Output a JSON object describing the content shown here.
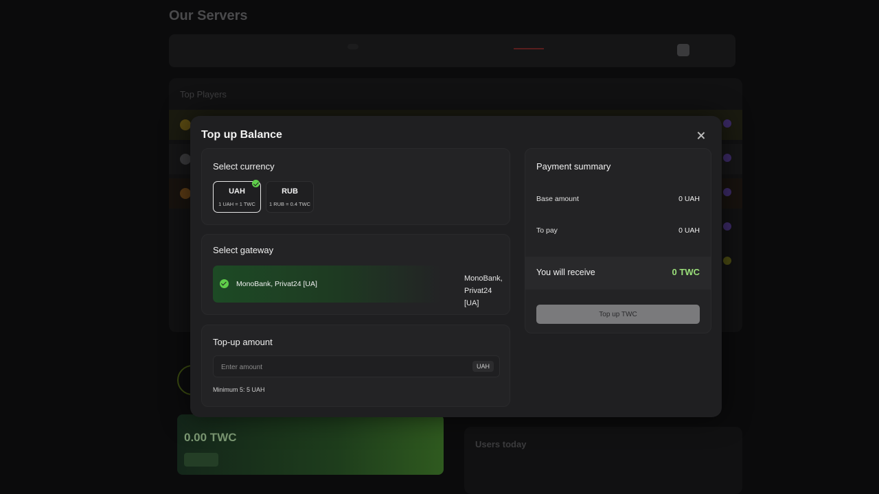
{
  "background": {
    "page_title": "Our Servers",
    "top_players_label": "Top Players",
    "balance_value": "0.00 TWC",
    "users_today_label": "Users today"
  },
  "modal": {
    "title": "Top up Balance",
    "currency": {
      "title": "Select currency",
      "options": [
        {
          "code": "UAH",
          "rate": "1 UAH = 1 TWC",
          "selected": true
        },
        {
          "code": "RUB",
          "rate": "1 RUB = 0.4 TWC",
          "selected": false
        }
      ]
    },
    "gateway": {
      "title": "Select gateway",
      "selected_name": "MonoBank, Privat24 [UA]",
      "side_label": "MonoBank, Privat24 [UA]"
    },
    "amount": {
      "title": "Top-up amount",
      "placeholder": "Enter amount",
      "value": "",
      "unit": "UAH",
      "minimum": "Minimum 5: 5 UAH"
    },
    "summary": {
      "title": "Payment summary",
      "base_label": "Base amount",
      "base_value": "0 UAH",
      "pay_label": "To pay",
      "pay_value": "0 UAH",
      "receive_label": "You will receive",
      "receive_value": "0 TWC",
      "button_label": "Top up TWC"
    },
    "colors": {
      "accent_green": "#9be07a",
      "check_green": "#5fcf4a",
      "modal_bg": "#1f1f21"
    },
    "icons": [
      "close-icon",
      "check-icon"
    ]
  }
}
